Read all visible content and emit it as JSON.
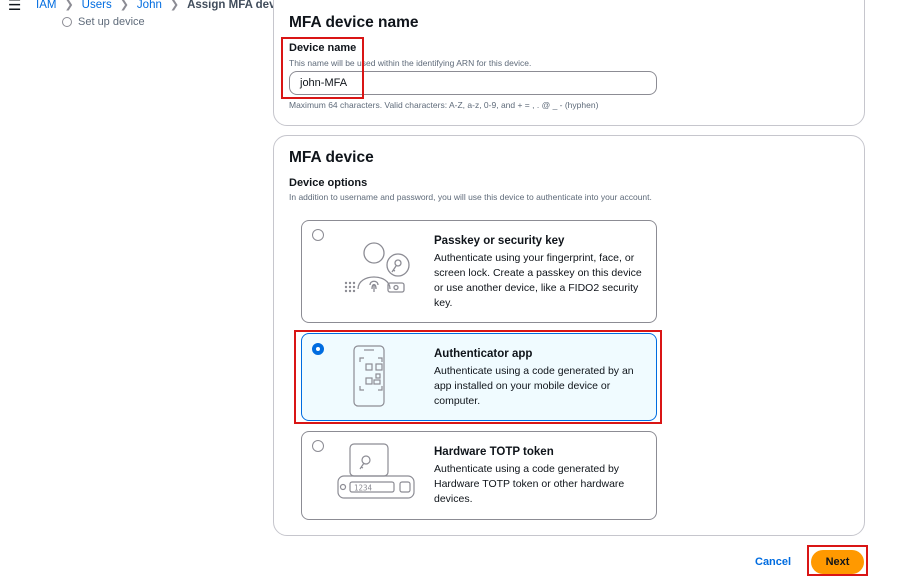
{
  "breadcrumb": {
    "items": [
      "IAM",
      "Users",
      "John"
    ],
    "current": "Assign MFA device"
  },
  "steps": {
    "setup_label": "Set up device"
  },
  "device_name_section": {
    "title": "MFA device name",
    "label": "Device name",
    "description": "This name will be used within the identifying ARN for this device.",
    "value": "john-MFA",
    "constraint": "Maximum 64 characters. Valid characters: A-Z, a-z, 0-9, and + = , . @ _ - (hyphen)"
  },
  "mfa_device_section": {
    "title": "MFA device",
    "options_label": "Device options",
    "options_description": "In addition to username and password, you will use this device to authenticate into your account.",
    "options": [
      {
        "title": "Passkey or security key",
        "description": "Authenticate using your fingerprint, face, or screen lock. Create a passkey on this device or use another device, like a FIDO2 security key.",
        "selected": false,
        "icon": "passkey-illustration-icon"
      },
      {
        "title": "Authenticator app",
        "description": "Authenticate using a code generated by an app installed on your mobile device or computer.",
        "selected": true,
        "icon": "phone-qr-illustration-icon"
      },
      {
        "title": "Hardware TOTP token",
        "description": "Authenticate using a code generated by Hardware TOTP token or other hardware devices.",
        "selected": false,
        "icon": "hardware-token-illustration-icon"
      }
    ],
    "token_display": "1234"
  },
  "footer": {
    "cancel_label": "Cancel",
    "next_label": "Next"
  },
  "colors": {
    "accent": "#006ce0",
    "primary_button": "#ff9900",
    "highlight": "#d91515"
  }
}
